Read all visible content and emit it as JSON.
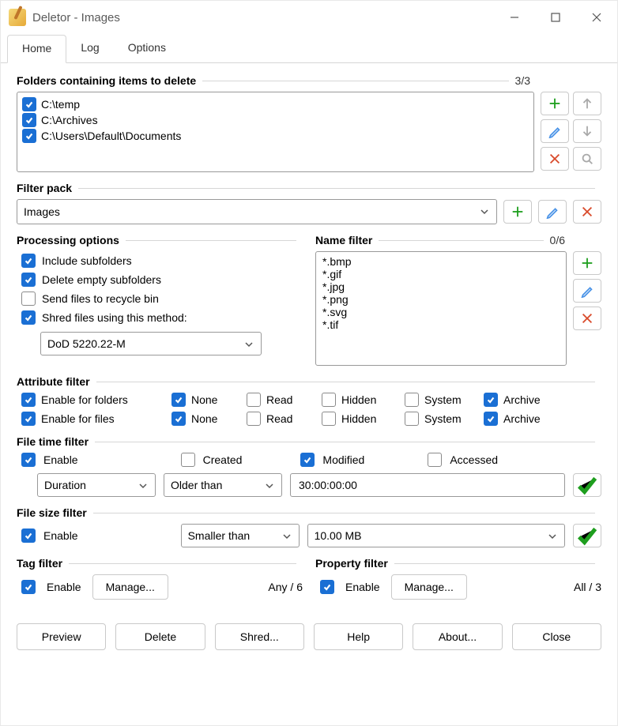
{
  "window": {
    "title": "Deletor - Images"
  },
  "tabs": {
    "home": "Home",
    "log": "Log",
    "options": "Options"
  },
  "folders": {
    "title": "Folders containing items to delete",
    "count": "3/3",
    "items": [
      {
        "checked": true,
        "path": "C:\\temp"
      },
      {
        "checked": true,
        "path": "C:\\Archives"
      },
      {
        "checked": true,
        "path": "C:\\Users\\Default\\Documents"
      }
    ]
  },
  "filter_pack": {
    "title": "Filter pack",
    "value": "Images"
  },
  "processing": {
    "title": "Processing options",
    "include_subfolders": {
      "checked": true,
      "label": "Include subfolders"
    },
    "delete_empty": {
      "checked": true,
      "label": "Delete empty subfolders"
    },
    "recycle": {
      "checked": false,
      "label": "Send files to recycle bin"
    },
    "shred": {
      "checked": true,
      "label": "Shred files using this method:"
    },
    "shred_method": "DoD 5220.22-M"
  },
  "name_filter": {
    "title": "Name filter",
    "count": "0/6",
    "patterns": [
      "*.bmp",
      "*.gif",
      "*.jpg",
      "*.png",
      "*.svg",
      "*.tif"
    ]
  },
  "attribute_filter": {
    "title": "Attribute filter",
    "folders": {
      "enable_label": "Enable for folders",
      "enable": true,
      "none": true,
      "read": false,
      "hidden": false,
      "system": false,
      "archive": true
    },
    "files": {
      "enable_label": "Enable for files",
      "enable": true,
      "none": true,
      "read": false,
      "hidden": false,
      "system": false,
      "archive": true
    },
    "labels": {
      "none": "None",
      "read": "Read",
      "hidden": "Hidden",
      "system": "System",
      "archive": "Archive"
    }
  },
  "time_filter": {
    "title": "File time filter",
    "enable": true,
    "enable_label": "Enable",
    "created": false,
    "created_label": "Created",
    "modified": true,
    "modified_label": "Modified",
    "accessed": false,
    "accessed_label": "Accessed",
    "mode": "Duration",
    "comparison": "Older than",
    "value": "30:00:00:00"
  },
  "size_filter": {
    "title": "File size filter",
    "enable": true,
    "enable_label": "Enable",
    "comparison": "Smaller than",
    "value": "10.00 MB"
  },
  "tag_filter": {
    "title": "Tag filter",
    "enable": true,
    "enable_label": "Enable",
    "manage": "Manage...",
    "summary": "Any / 6"
  },
  "property_filter": {
    "title": "Property filter",
    "enable": true,
    "enable_label": "Enable",
    "manage": "Manage...",
    "summary": "All / 3"
  },
  "buttons": {
    "preview": "Preview",
    "delete": "Delete",
    "shred": "Shred...",
    "help": "Help",
    "about": "About...",
    "close": "Close"
  }
}
